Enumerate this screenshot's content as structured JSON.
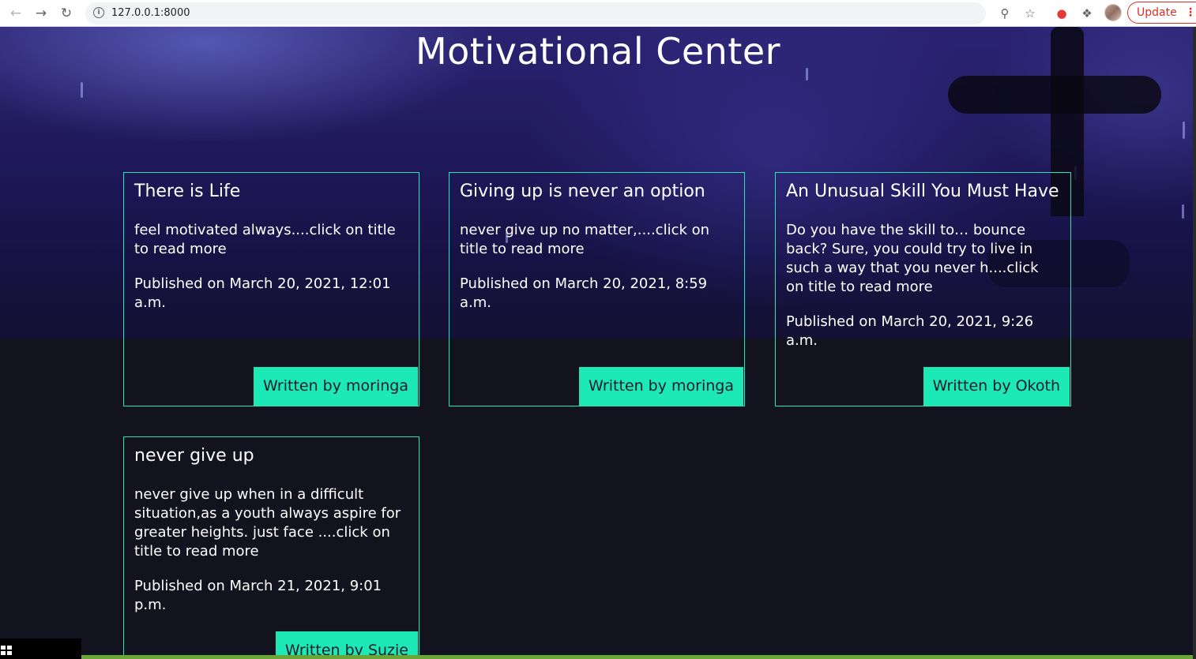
{
  "browser": {
    "url": "127.0.0.1:8000",
    "update_label": "Update",
    "icons": [
      "back-icon",
      "forward-icon",
      "reload-icon",
      "info-icon",
      "zoom-icon",
      "star-icon",
      "extension-icon",
      "puzzle-icon",
      "avatar"
    ]
  },
  "page": {
    "title": "Motivational Center"
  },
  "posts": [
    {
      "title": "There is Life",
      "excerpt": "feel motivated always....click on title to read more",
      "published": "Published on March 20, 2021, 12:01 a.m.",
      "author": "Written by moringa"
    },
    {
      "title": "Giving up is never an option",
      "excerpt": "never give up no matter,....click on title to read more",
      "published": "Published on March 20, 2021, 8:59 a.m.",
      "author": "Written by moringa"
    },
    {
      "title": "An Unusual Skill You Must Have",
      "excerpt": "Do you have the skill to… bounce back? Sure, you could try to live in such a way that you never h....click on title to read more",
      "published": "Published on March 20, 2021, 9:26 a.m.",
      "author": "Written by Okoth"
    },
    {
      "title": "never give up",
      "excerpt": "never give up when in a difficult situation,as a youth always aspire for greater heights. just face ....click on title to read more",
      "published": "Published on March 21, 2021, 9:01 p.m.",
      "author": "Written by Suzie"
    }
  ],
  "colors": {
    "accent": "#1de9b6",
    "background": "#13121f"
  }
}
